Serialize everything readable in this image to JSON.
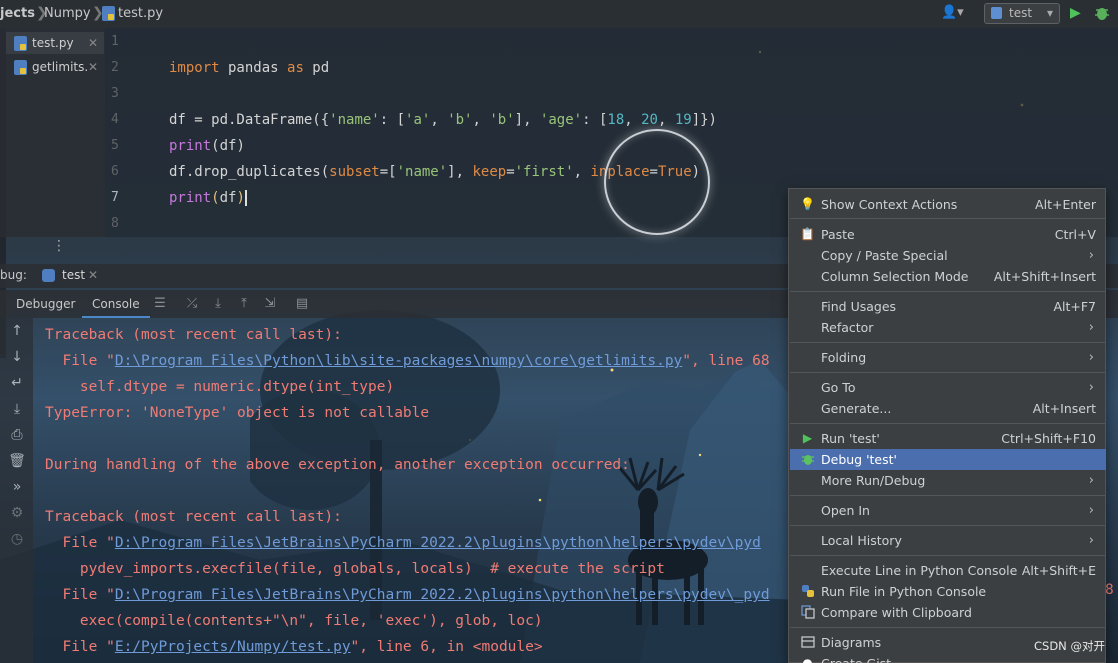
{
  "breadcrumb": {
    "items": [
      "jects",
      "Numpy",
      "test.py"
    ]
  },
  "toolbar": {
    "run_config": "test",
    "user_icon": "user-icon",
    "run_icon": "run-icon",
    "debug_icon": "bug-icon"
  },
  "editor_tabs": [
    {
      "label": "test.py"
    },
    {
      "label": "getlimits."
    }
  ],
  "line_numbers": [
    "1",
    "2",
    "3",
    "4",
    "5",
    "6",
    "7",
    "8"
  ],
  "code": {
    "l2_kw1": "import",
    "l2_mod": " pandas ",
    "l2_kw2": "as",
    "l2_alias": " pd",
    "l4_a": "df = pd.DataFrame({",
    "l4_s1": "'name'",
    "l4_b": ": [",
    "l4_s2": "'a'",
    "l4_c": ", ",
    "l4_s3": "'b'",
    "l4_d": ", ",
    "l4_s4": "'b'",
    "l4_e": "], ",
    "l4_s5": "'age'",
    "l4_f": ": [",
    "l4_n1": "18",
    "l4_g": ", ",
    "l4_n2": "20",
    "l4_h": ", ",
    "l4_n3": "19",
    "l4_i": "]})",
    "l5_fn": "print",
    "l5_rest": "(df)",
    "l6_a": "df.drop_duplicates(",
    "l6_p1": "subset",
    "l6_b": "=[",
    "l6_s1": "'name'",
    "l6_c": "], ",
    "l6_p2": "keep",
    "l6_d": "=",
    "l6_s2": "'first'",
    "l6_e": ", ",
    "l6_p3": "inplace",
    "l6_f": "=",
    "l6_v": "True",
    "l6_g": ")",
    "l7_fn": "print",
    "l7_p1": "(",
    "l7_arg": "df",
    "l7_p2": ")"
  },
  "debug": {
    "label": "bug:",
    "session": "test",
    "tab_debugger": "Debugger",
    "tab_console": "Console"
  },
  "console": {
    "l1": "Traceback (most recent call last):",
    "l2_pre": "  File \"",
    "l2_link": "D:\\Program Files\\Python\\lib\\site-packages\\numpy\\core\\getlimits.py",
    "l2_post": "\", line 68",
    "l3": "    self.dtype = numeric.dtype(int_type)",
    "l4": "TypeError: 'NoneType' object is not callable",
    "l6": "During handling of the above exception, another exception occurred:",
    "l8": "Traceback (most recent call last):",
    "l9_pre": "  File \"",
    "l9_link": "D:\\Program Files\\JetBrains\\PyCharm 2022.2\\plugins\\python\\helpers\\pydev\\pyd",
    "l10": "    pydev_imports.execfile(file, globals, locals)  # execute the script",
    "l11_pre": "  File \"",
    "l11_link": "D:\\Program Files\\JetBrains\\PyCharm 2022.2\\plugins\\python\\helpers\\pydev\\_pyd",
    "l11_post": "8",
    "l12": "    exec(compile(contents+\"\\n\", file, 'exec'), glob, loc)",
    "l13_pre": "  File \"",
    "l13_link": "E:/PyProjects/Numpy/test.py",
    "l13_post": "\", line 6, in <module>"
  },
  "context_menu": {
    "items": [
      {
        "label": "Show Context Actions",
        "shortcut": "Alt+Enter",
        "icon": "bulb-icon"
      },
      {
        "label": "Paste",
        "shortcut": "Ctrl+V",
        "icon": "clipboard-icon"
      },
      {
        "label": "Copy / Paste Special",
        "shortcut": "",
        "submenu": true
      },
      {
        "label": "Column Selection Mode",
        "shortcut": "Alt+Shift+Insert"
      },
      {
        "label": "Find Usages",
        "shortcut": "Alt+F7"
      },
      {
        "label": "Refactor",
        "shortcut": "",
        "submenu": true
      },
      {
        "label": "Folding",
        "shortcut": "",
        "submenu": true
      },
      {
        "label": "Go To",
        "shortcut": "",
        "submenu": true
      },
      {
        "label": "Generate...",
        "shortcut": "Alt+Insert"
      },
      {
        "label": "Run 'test'",
        "shortcut": "Ctrl+Shift+F10",
        "icon": "run-icon"
      },
      {
        "label": "Debug 'test'",
        "shortcut": "",
        "icon": "bug-icon",
        "selected": true
      },
      {
        "label": "More Run/Debug",
        "shortcut": "",
        "submenu": true
      },
      {
        "label": "Open In",
        "shortcut": "",
        "submenu": true
      },
      {
        "label": "Local History",
        "shortcut": "",
        "submenu": true
      },
      {
        "label": "Execute Line in Python Console",
        "shortcut": "Alt+Shift+E"
      },
      {
        "label": "Run File in Python Console",
        "shortcut": "",
        "icon": "python-icon"
      },
      {
        "label": "Compare with Clipboard",
        "shortcut": "",
        "icon": "compare-icon"
      },
      {
        "label": "Diagrams",
        "shortcut": "",
        "icon": "diagram-icon"
      },
      {
        "label": "Create Gist...",
        "shortcut": "",
        "icon": "github-icon"
      }
    ]
  },
  "watermark": "CSDN @对开"
}
